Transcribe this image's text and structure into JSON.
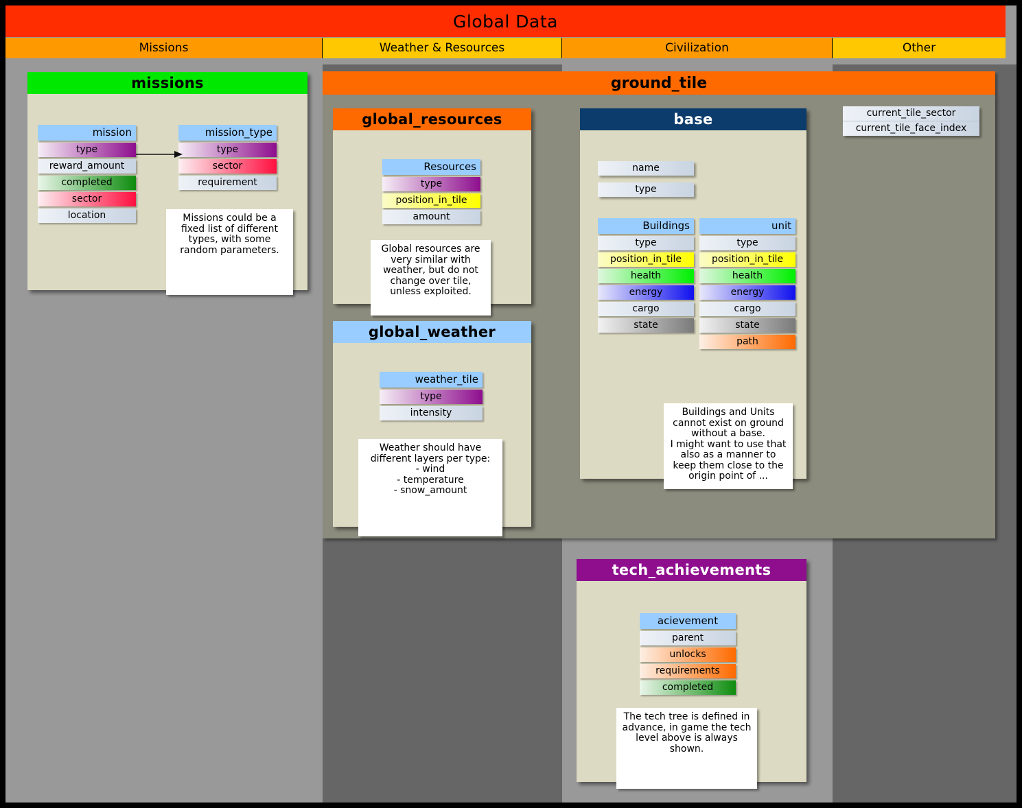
{
  "header": {
    "title": "Global Data"
  },
  "tabs": [
    {
      "label": "Missions",
      "color": "#FF9900"
    },
    {
      "label": "Weather & Resources",
      "color": "#FFC800"
    },
    {
      "label": "Civilization",
      "color": "#FF9900"
    },
    {
      "label": "Other",
      "color": "#FFC800"
    }
  ],
  "regions": {
    "ground_tile": {
      "title": "ground_tile",
      "color": "#FF6A00"
    }
  },
  "cards": {
    "missions": {
      "title": "missions",
      "head_color": "#00E800",
      "head_text_color": "#000000",
      "entities": [
        {
          "name": "mission",
          "attrs": [
            {
              "label": "type",
              "style": "a-purple"
            },
            {
              "label": "reward_amount",
              "style": "a-plain"
            },
            {
              "label": "completed",
              "style": "a-green"
            },
            {
              "label": "sector",
              "style": "a-red"
            },
            {
              "label": "location",
              "style": "a-plain"
            }
          ]
        },
        {
          "name": "mission_type",
          "attrs": [
            {
              "label": "type",
              "style": "a-purple"
            },
            {
              "label": "sector",
              "style": "a-red"
            },
            {
              "label": "requirement",
              "style": "a-plain"
            }
          ]
        }
      ],
      "note": "Missions could be a fixed list of different types, with some random parameters."
    },
    "global_resources": {
      "title": "global_resources",
      "head_color": "#FF6A00",
      "head_text_color": "#000000",
      "entities": [
        {
          "name": "Resources",
          "attrs": [
            {
              "label": "type",
              "style": "a-purple"
            },
            {
              "label": "position_in_tile",
              "style": "a-yellow"
            },
            {
              "label": "amount",
              "style": "a-plain"
            }
          ]
        }
      ],
      "note": "Global resources are very similar with weather, but do not change over tile, unless exploited."
    },
    "global_weather": {
      "title": "global_weather",
      "head_color": "#99CCFF",
      "head_text_color": "#000000",
      "entities": [
        {
          "name": "weather_tile",
          "attrs": [
            {
              "label": "type",
              "style": "a-purple"
            },
            {
              "label": "intensity",
              "style": "a-plain"
            }
          ]
        }
      ],
      "note": "Weather should have different layers per type:\n- wind\n- temperature\n- snow_amount"
    },
    "base": {
      "title": "base",
      "head_color": "#0B3C6B",
      "head_text_color": "#FFFFFF",
      "root_attrs": [
        {
          "label": "name",
          "style": "a-plain"
        },
        {
          "label": "type",
          "style": "a-plain"
        }
      ],
      "entities": [
        {
          "name": "Buildings",
          "attrs": [
            {
              "label": "type",
              "style": "a-plain"
            },
            {
              "label": "position_in_tile",
              "style": "a-yellow"
            },
            {
              "label": "health",
              "style": "a-lime"
            },
            {
              "label": "energy",
              "style": "a-blue"
            },
            {
              "label": "cargo",
              "style": "a-plain"
            },
            {
              "label": "state",
              "style": "a-gray"
            }
          ]
        },
        {
          "name": "unit",
          "attrs": [
            {
              "label": "type",
              "style": "a-plain"
            },
            {
              "label": "position_in_tile",
              "style": "a-yellow"
            },
            {
              "label": "health",
              "style": "a-lime"
            },
            {
              "label": "energy",
              "style": "a-blue"
            },
            {
              "label": "cargo",
              "style": "a-plain"
            },
            {
              "label": "state",
              "style": "a-gray"
            },
            {
              "label": "path",
              "style": "a-orange"
            }
          ]
        }
      ],
      "note": "Buildings and Units cannot exist on ground without a base.\nI might want to use that also as a manner to keep them close to the origin point of ..."
    },
    "tech_achievements": {
      "title": "tech_achievements",
      "head_color": "#8E0E8E",
      "head_text_color": "#FFFFFF",
      "entities": [
        {
          "name": "acievement",
          "attrs": [
            {
              "label": "parent",
              "style": "a-plain"
            },
            {
              "label": "unlocks",
              "style": "a-orange"
            },
            {
              "label": "requirements",
              "style": "a-orange"
            },
            {
              "label": "completed",
              "style": "a-green"
            }
          ]
        }
      ],
      "note": "The tech tree is defined in advance, in game the tech level above is always shown."
    }
  },
  "other_column": {
    "attrs": [
      {
        "label": "current_tile_sector",
        "style": "a-plain"
      },
      {
        "label": "current_tile_face_index",
        "style": "a-plain"
      }
    ]
  }
}
